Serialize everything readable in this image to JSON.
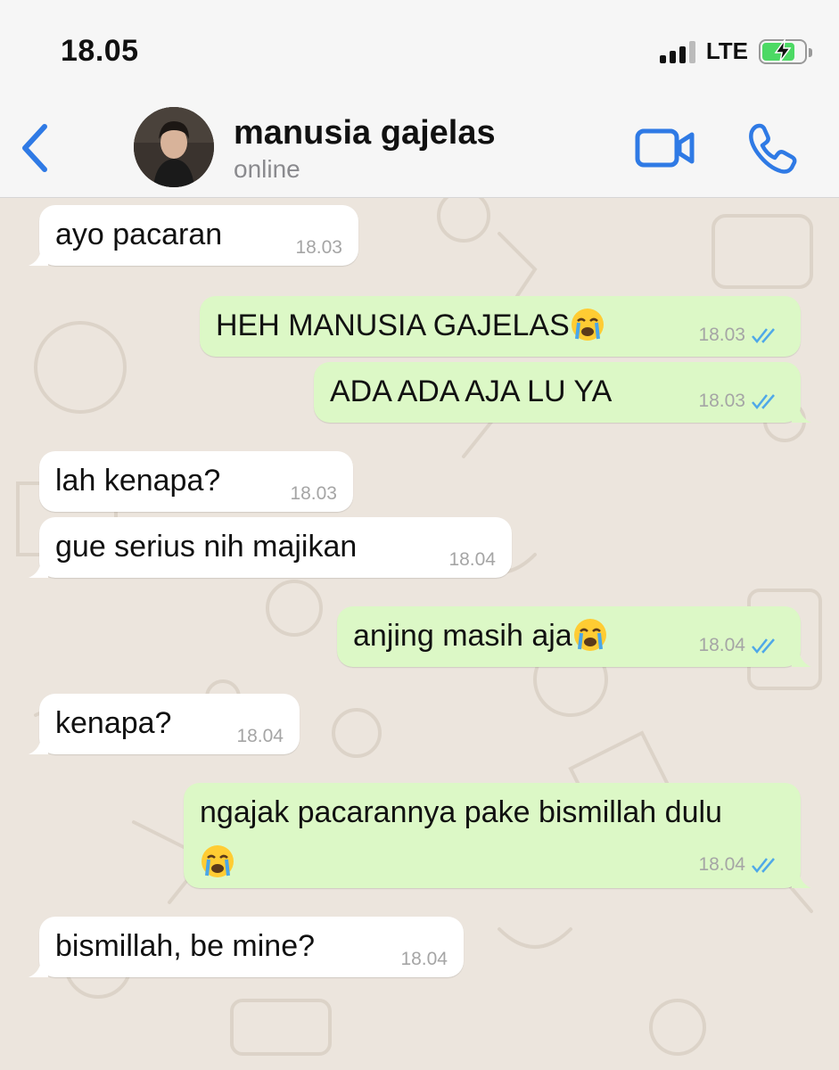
{
  "status_bar": {
    "time": "18.05",
    "network": "LTE"
  },
  "header": {
    "contact_name": "manusia gajelas",
    "contact_status": "online",
    "icons": [
      "back-chevron-icon",
      "video-call-icon",
      "phone-icon"
    ],
    "accent_color": "#2f7ae5"
  },
  "messages": [
    {
      "direction": "in",
      "text": "ayo pacaran",
      "time": "18.03"
    },
    {
      "direction": "out",
      "text": "HEH MANUSIA GAJELAS",
      "emoji": "loudly-crying-face",
      "time": "18.03",
      "read": true
    },
    {
      "direction": "out",
      "text": "ADA ADA AJA LU YA",
      "time": "18.03",
      "read": true
    },
    {
      "direction": "in",
      "text": "lah kenapa?",
      "time": "18.03"
    },
    {
      "direction": "in",
      "text": "gue serius nih majikan",
      "time": "18.04"
    },
    {
      "direction": "out",
      "text": "anjing masih aja",
      "emoji": "loudly-crying-face",
      "time": "18.04",
      "read": true
    },
    {
      "direction": "in",
      "text": "kenapa?",
      "time": "18.04"
    },
    {
      "direction": "out",
      "text": "ngajak pacarannya pake bismillah dulu",
      "emoji": "loudly-crying-face",
      "time": "18.04",
      "read": true
    },
    {
      "direction": "in",
      "text": "bismillah, be mine?",
      "time": "18.04"
    }
  ],
  "colors": {
    "incoming_bubble": "#ffffff",
    "outgoing_bubble": "#dcf8c6",
    "wallpaper": "#ece5dd",
    "read_ticks": "#4fa8e8"
  }
}
